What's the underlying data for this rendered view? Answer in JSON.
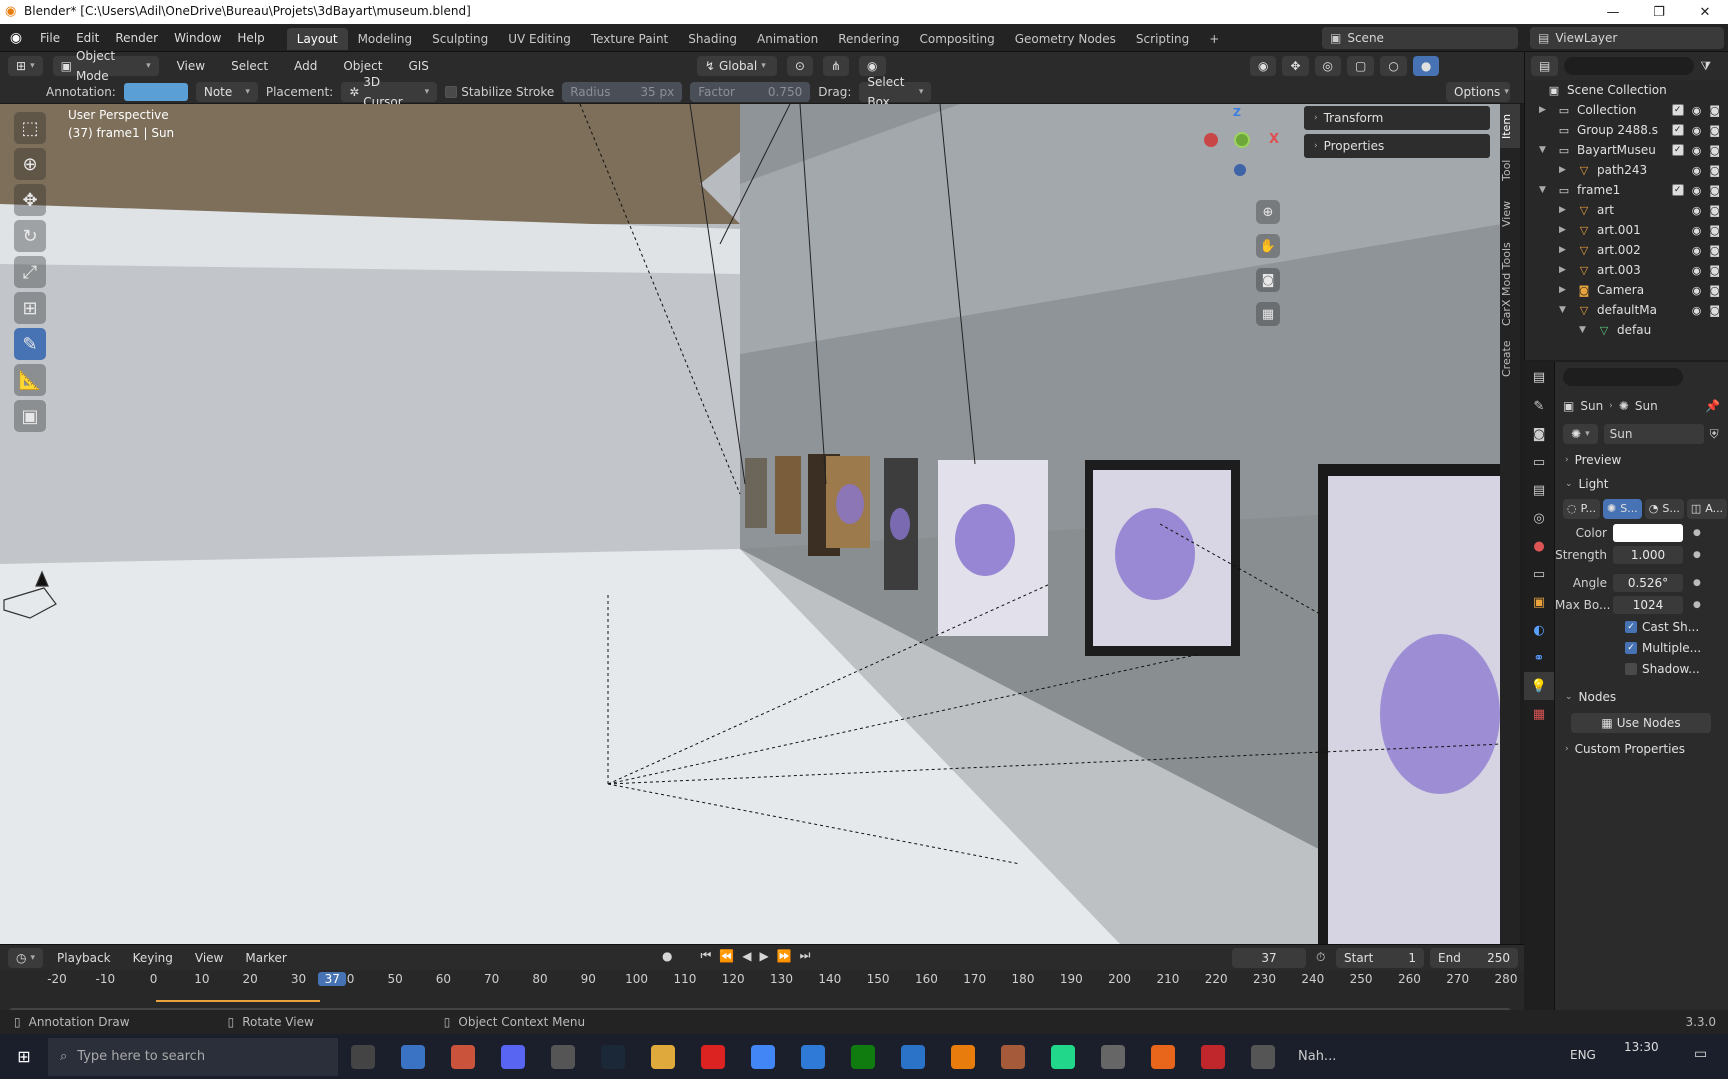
{
  "titlebar": {
    "title": "Blender* [C:\\Users\\Adil\\OneDrive\\Bureau\\Projets\\3dBayart\\museum.blend]",
    "minimize": "—",
    "maximize": "❐",
    "close": "✕"
  },
  "menu": [
    "File",
    "Edit",
    "Render",
    "Window",
    "Help"
  ],
  "workspaces": [
    "Layout",
    "Modeling",
    "Sculpting",
    "UV Editing",
    "Texture Paint",
    "Shading",
    "Animation",
    "Rendering",
    "Compositing",
    "Geometry Nodes",
    "Scripting"
  ],
  "workspace_add": "+",
  "scene": {
    "label": "Scene",
    "viewlayer": "ViewLayer"
  },
  "header": {
    "mode": "Object Mode",
    "menus": [
      "View",
      "Select",
      "Add",
      "Object",
      "GIS"
    ],
    "orientation": "Global"
  },
  "toolsettings": {
    "annotation_label": "Annotation:",
    "note": "Note",
    "placement_label": "Placement:",
    "placement": "3D Cursor",
    "stabilize": "Stabilize Stroke",
    "radius_label": "Radius",
    "radius_value": "35 px",
    "factor_label": "Factor",
    "factor_value": "0.750",
    "drag_label": "Drag:",
    "drag_value": "Select Box",
    "options": "Options"
  },
  "viewport": {
    "perspective": "User Perspective",
    "object_info": "(37) frame1 | Sun",
    "gizmo": {
      "z": "Z",
      "x": "X"
    }
  },
  "npanel": {
    "transform": "Transform",
    "properties": "Properties"
  },
  "vtabs": [
    "Item",
    "Tool",
    "View",
    "CarX Mod Tools",
    "Create"
  ],
  "outliner": {
    "root": "Scene Collection",
    "items": [
      {
        "name": "Collection",
        "indent": 1
      },
      {
        "name": "Group 2488.s",
        "indent": 1
      },
      {
        "name": "BayartMuseu",
        "indent": 1
      },
      {
        "name": "path243",
        "indent": 2
      },
      {
        "name": "frame1",
        "indent": 1
      },
      {
        "name": "art",
        "indent": 2
      },
      {
        "name": "art.001",
        "indent": 2
      },
      {
        "name": "art.002",
        "indent": 2
      },
      {
        "name": "art.003",
        "indent": 2
      },
      {
        "name": "Camera",
        "indent": 2
      },
      {
        "name": "defaultMa",
        "indent": 2
      },
      {
        "name": "defau",
        "indent": 3
      }
    ]
  },
  "properties": {
    "breadcrumb_a": "Sun",
    "breadcrumb_b": "Sun",
    "datablock": "Sun",
    "preview": "Preview",
    "light": "Light",
    "light_types": [
      "P...",
      "S...",
      "S...",
      "A..."
    ],
    "color_label": "Color",
    "strength_label": "Strength",
    "strength": "1.000",
    "angle_label": "Angle",
    "angle": "0.526°",
    "maxbounce_label": "Max Bo...",
    "maxbounce": "1024",
    "cast_shadow": "Cast Sh...",
    "multiple": "Multiple...",
    "shadow": "Shadow...",
    "nodes": "Nodes",
    "use_nodes": "Use Nodes",
    "custom": "Custom Properties"
  },
  "timeline": {
    "menus": [
      "Playback",
      "Keying",
      "View",
      "Marker"
    ],
    "current": "37",
    "start_label": "Start",
    "start": "1",
    "end_label": "End",
    "end": "250",
    "ticks": [
      "-20",
      "-10",
      "0",
      "10",
      "20",
      "30",
      "37",
      "40",
      "50",
      "60",
      "70",
      "80",
      "90",
      "100",
      "110",
      "120",
      "130",
      "140",
      "150",
      "160",
      "170",
      "180",
      "190",
      "200",
      "210",
      "220",
      "230",
      "240",
      "250",
      "260",
      "270",
      "280"
    ]
  },
  "status": {
    "left": "Annotation Draw",
    "mid": "Rotate View",
    "right": "Object Context Menu",
    "version": "3.3.0"
  },
  "taskbar": {
    "search": "Type here to search",
    "lang": "ENG",
    "time": "13:30",
    "nah": "Nah..."
  }
}
